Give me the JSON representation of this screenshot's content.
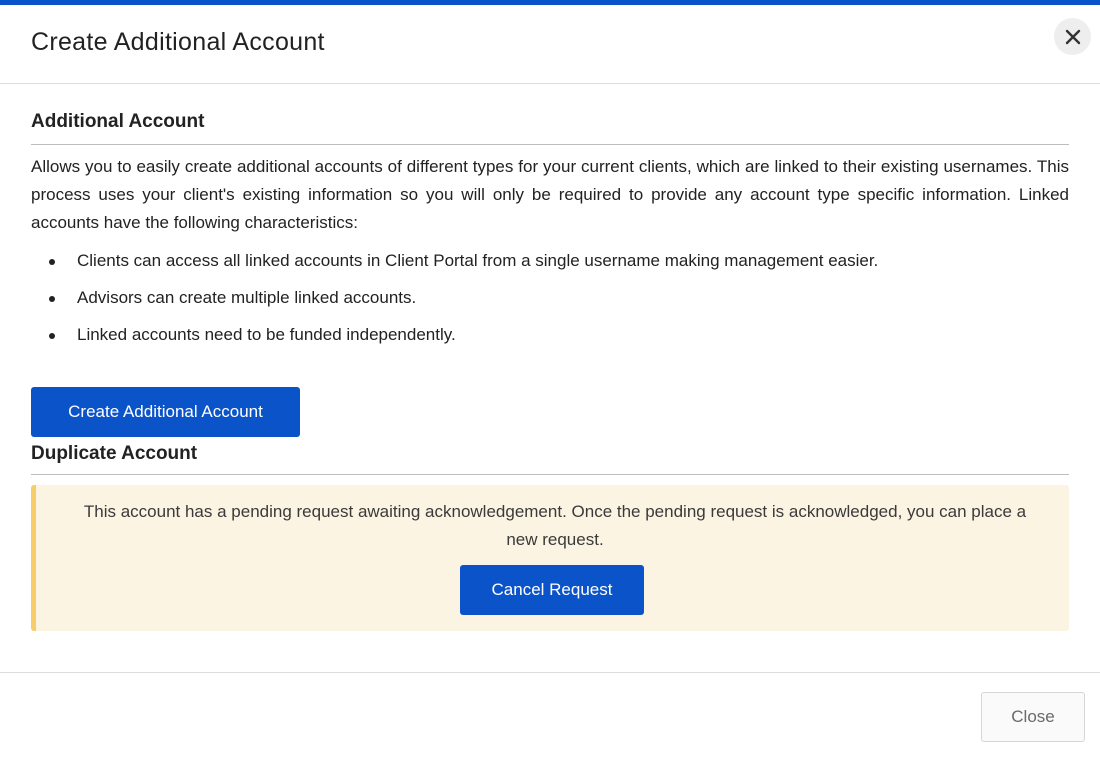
{
  "modal": {
    "title": "Create Additional Account",
    "accent_color": "#0a53c8",
    "close_icon": "close-x-icon"
  },
  "additional_account": {
    "heading": "Additional Account",
    "description": "Allows you to easily create additional accounts of different types for your current clients, which are linked to their existing usernames. This process uses your client's existing information so you will only be required to provide any account type specific information. Linked accounts have the following characteristics:",
    "bullets": [
      "Clients can access all linked accounts in Client Portal from a single username making management easier.",
      "Advisors can create multiple linked accounts.",
      "Linked accounts need to be funded independently."
    ],
    "button_label": "Create Additional Account"
  },
  "duplicate_account": {
    "heading": "Duplicate Account",
    "notice_text": "This account has a pending request awaiting acknowledgement. Once the pending request is acknowledged, you can place a new request.",
    "notice_bg_color": "#fcf4e3",
    "notice_border_color": "#f6cd6a",
    "button_label": "Cancel Request"
  },
  "footer": {
    "close_label": "Close"
  }
}
